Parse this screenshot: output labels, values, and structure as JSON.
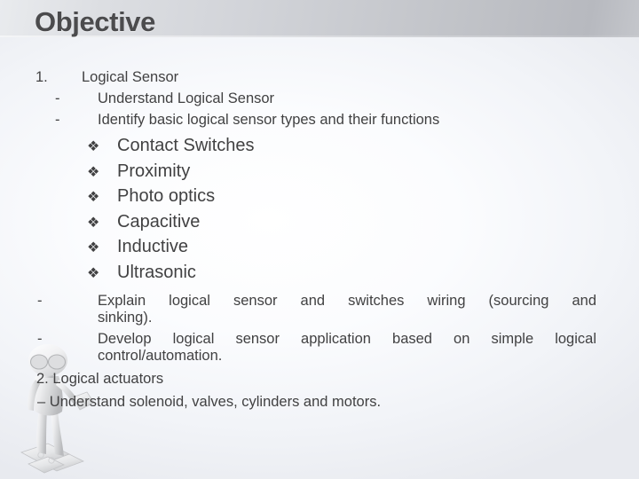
{
  "slide": {
    "title": "Objective",
    "title_color": "#4b4b4d",
    "text_color": "#414142",
    "header_band_color": "#c8cacf"
  },
  "outline": {
    "item1": {
      "number": "1.",
      "text": "Logical Sensor"
    },
    "sub1": {
      "marker": "-",
      "text": "Understand Logical Sensor"
    },
    "sub2": {
      "marker": "-",
      "text": "Identify basic logical sensor types and their functions"
    },
    "sensor_types": {
      "bullet": "❯",
      "bullet_glyph": "❖",
      "items": [
        "Contact Switches",
        "Proximity",
        "Photo optics",
        "Capacitive",
        "Inductive",
        "Ultrasonic"
      ]
    },
    "sub3": {
      "marker": "-",
      "line1": "Explain logical sensor and switches wiring (sourcing and",
      "line2": "sinking)."
    },
    "sub4": {
      "marker": "-",
      "line1": "Develop logical sensor application based on simple logical",
      "line2": "control/automation."
    },
    "item2": {
      "number": "2.",
      "text": "Logical actuators"
    },
    "sub5": {
      "marker": "–",
      "text": "Understand solenoid, valves, cylinders and motors."
    }
  },
  "decor": {
    "watermark": "mannequin-with-puzzle-piece"
  }
}
